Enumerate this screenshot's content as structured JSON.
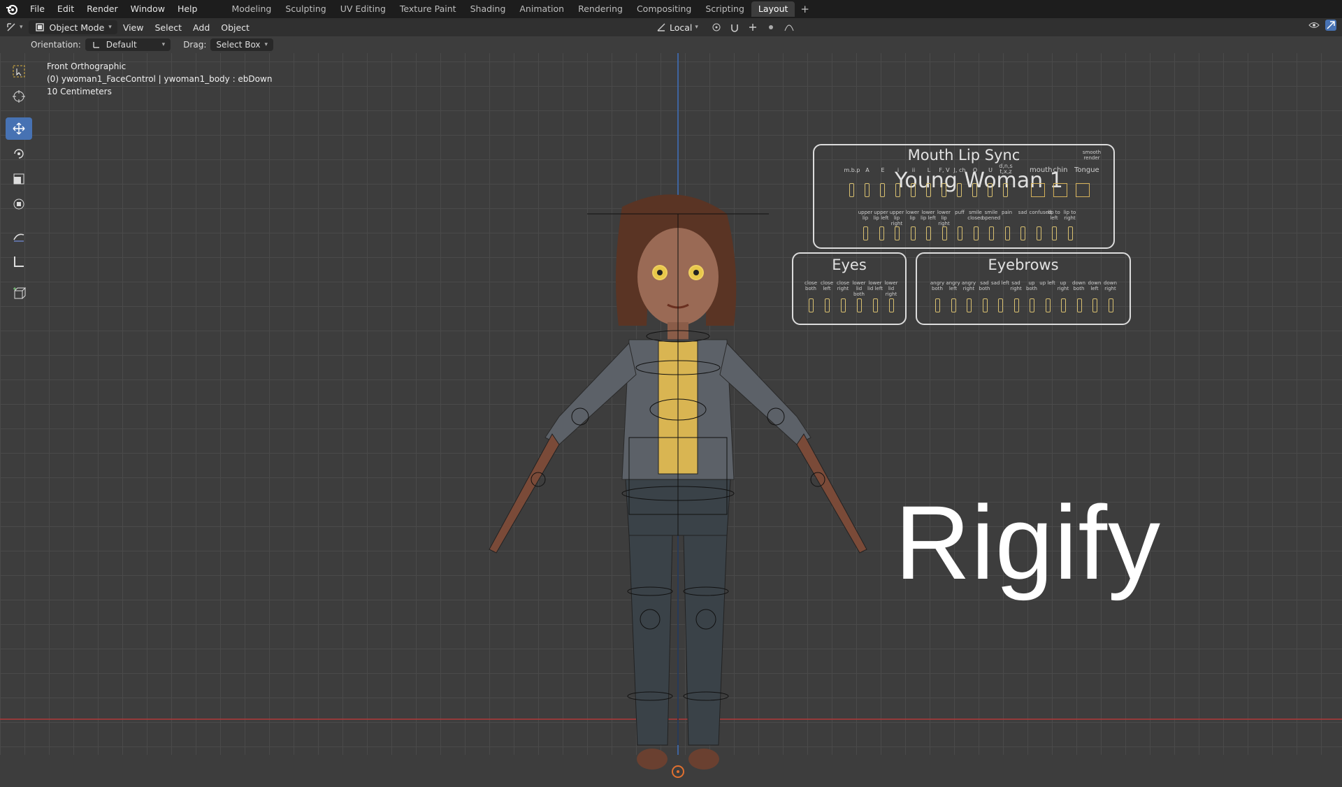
{
  "menu": {
    "items": [
      "File",
      "Edit",
      "Render",
      "Window",
      "Help"
    ],
    "workspaces": [
      "Modeling",
      "Sculpting",
      "UV Editing",
      "Texture Paint",
      "Shading",
      "Animation",
      "Rendering",
      "Compositing",
      "Scripting",
      "Layout"
    ],
    "active_workspace": "Layout",
    "add_symbol": "+"
  },
  "header": {
    "mode": "Object Mode",
    "menus": [
      "View",
      "Select",
      "Add",
      "Object"
    ],
    "transform_orientation": "Local"
  },
  "toolsettings": {
    "orientation_label": "Orientation:",
    "orientation_value": "Default",
    "drag_label": "Drag:",
    "drag_value": "Select Box"
  },
  "viewport": {
    "view_name": "Front Orthographic",
    "object_info": "(0) ywoman1_FaceControl | ywoman1_body : ebDown",
    "scale": "10 Centimeters",
    "overlay_big_text": "Rigify"
  },
  "face_control": {
    "title": "Young Woman 1",
    "mouth_title": "Mouth Lip Sync",
    "smooth_render": "smooth render",
    "mouth_labels": [
      "m.b.p",
      "A",
      "E",
      "i",
      "ii",
      "L",
      "F, V",
      "J, ch",
      "O",
      "U",
      "d,n,s t,x,z",
      "mouth",
      "chin",
      "Tongue"
    ],
    "mouth_row2_labels": [
      "upper lip",
      "upper lip left",
      "upper lip right",
      "lower lip",
      "lower lip left",
      "lower lip right",
      "puff",
      "smile closed",
      "smile opened",
      "pain",
      "sad",
      "confused",
      "lip to left",
      "lip to right"
    ],
    "eyes_title": "Eyes",
    "eyes_labels": [
      "close both",
      "close left",
      "close right",
      "lower lid both",
      "lower lid left",
      "lower lid right"
    ],
    "eyebrows_title": "Eyebrows",
    "eyebrows_labels": [
      "angry both",
      "angry left",
      "angry right",
      "sad both",
      "sad left",
      "sad right",
      "up both",
      "up left",
      "up right",
      "down both",
      "down left",
      "down right"
    ]
  },
  "colors": {
    "accent": "#4772b3",
    "axis_z": "#3e6bb0",
    "axis_x": "#a33a3a",
    "slider": "#d9c070"
  }
}
